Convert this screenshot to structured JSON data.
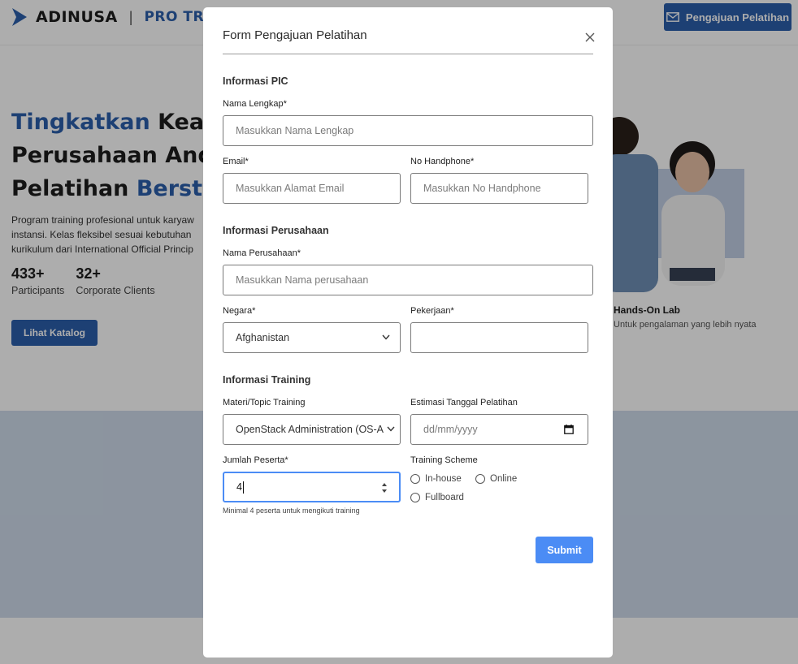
{
  "header": {
    "brand_name": "ADINUSA",
    "brand_separator": "|",
    "brand_sub": "PRO TRAIN",
    "cta_label": "Pengajuan Pelatihan",
    "cta_icon": "mail-icon"
  },
  "hero": {
    "title_line1_highlight": "Tingkatkan",
    "title_line1_rest": " Keahl",
    "title_line2": "Perusahaan Anda",
    "title_line3_start": "Pelatihan ",
    "title_line3_highlight": "Berstan",
    "desc_line1": "Program training profesional untuk karyaw",
    "desc_line2": "instansi. Kelas fleksibel sesuai kebutuhan",
    "desc_line3": "kurikulum dari International Official Princip",
    "stats": [
      {
        "value": "433+",
        "label": "Participants"
      },
      {
        "value": "32+",
        "label": "Corporate Clients"
      }
    ],
    "catalog_button": "Lihat Katalog",
    "lab_title": "Hands-On Lab",
    "lab_subtitle": "Untuk pengalaman yang lebih nyata"
  },
  "modal": {
    "title": "Form Pengajuan Pelatihan",
    "close_icon": "close-icon",
    "sections": {
      "pic": "Informasi PIC",
      "company": "Informasi Perusahaan",
      "training": "Informasi Training"
    },
    "fields": {
      "full_name": {
        "label": "Nama Lengkap*",
        "placeholder": "Masukkan Nama Lengkap"
      },
      "email": {
        "label": "Email*",
        "placeholder": "Masukkan Alamat Email"
      },
      "phone": {
        "label": "No Handphone*",
        "placeholder": "Masukkan No Handphone"
      },
      "company_name": {
        "label": "Nama Perusahaan*",
        "placeholder": "Masukkan Nama perusahaan"
      },
      "country": {
        "label": "Negara*",
        "value": "Afghanistan"
      },
      "job": {
        "label": "Pekerjaan*",
        "value": ""
      },
      "topic": {
        "label": "Materi/Topic Training",
        "value": "OpenStack Administration (OS-A"
      },
      "date": {
        "label": "Estimasi Tanggal Pelatihan",
        "placeholder": "dd/mm/yyyy"
      },
      "participants": {
        "label": "Jumlah Peserta*",
        "value": "4",
        "hint": "Minimal 4 peserta untuk mengikuti training"
      }
    },
    "training_scheme": {
      "label": "Training Scheme",
      "options": [
        "In-house",
        "Online",
        "Fullboard"
      ]
    },
    "submit_label": "Submit"
  },
  "colors": {
    "brand_blue": "#2c5fab",
    "submit_blue": "#4b8cf5",
    "band_blue": "#cfdbea"
  }
}
